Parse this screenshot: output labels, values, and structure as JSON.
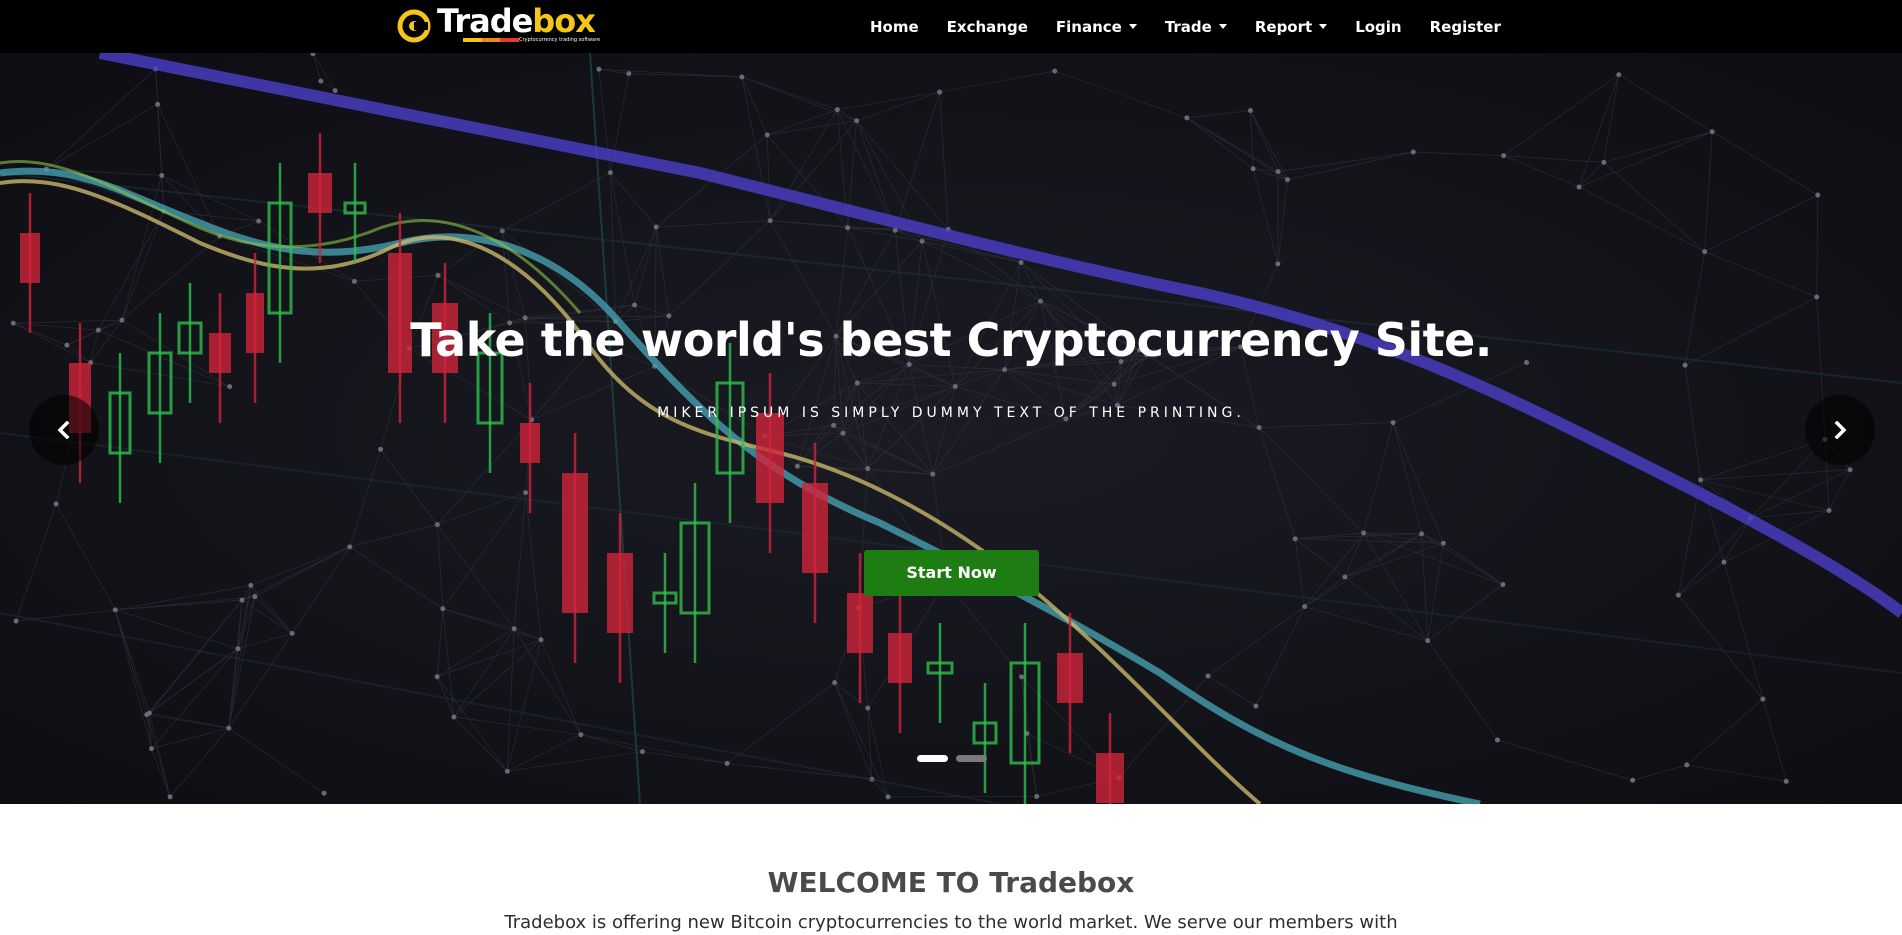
{
  "brand": {
    "name_part1": "Trade",
    "name_part2": "box",
    "tagline": "Cryptocurrency trading software",
    "accent": "#f5c518",
    "bar_colors": [
      "#f5c518",
      "#f08a1c",
      "#e53935"
    ]
  },
  "nav": {
    "items": [
      {
        "label": "Home",
        "dropdown": false
      },
      {
        "label": "Exchange",
        "dropdown": false
      },
      {
        "label": "Finance",
        "dropdown": true
      },
      {
        "label": "Trade",
        "dropdown": true
      },
      {
        "label": "Report",
        "dropdown": true
      },
      {
        "label": "Login",
        "dropdown": false
      },
      {
        "label": "Register",
        "dropdown": false
      }
    ]
  },
  "hero": {
    "title": "Take the world's best Cryptocurrency Site.",
    "subtitle": "MIKER IPSUM IS SIMPLY DUMMY TEXT OF THE PRINTING.",
    "cta_label": "Start Now",
    "cta_color": "#1e7d12",
    "prev_icon": "chevron-left-icon",
    "next_icon": "chevron-right-icon",
    "slide_count": 2,
    "active_slide": 1
  },
  "welcome": {
    "title": "WELCOME TO Tradebox",
    "text": "Tradebox is offering new Bitcoin cryptocurrencies to the world market. We serve our members with"
  }
}
